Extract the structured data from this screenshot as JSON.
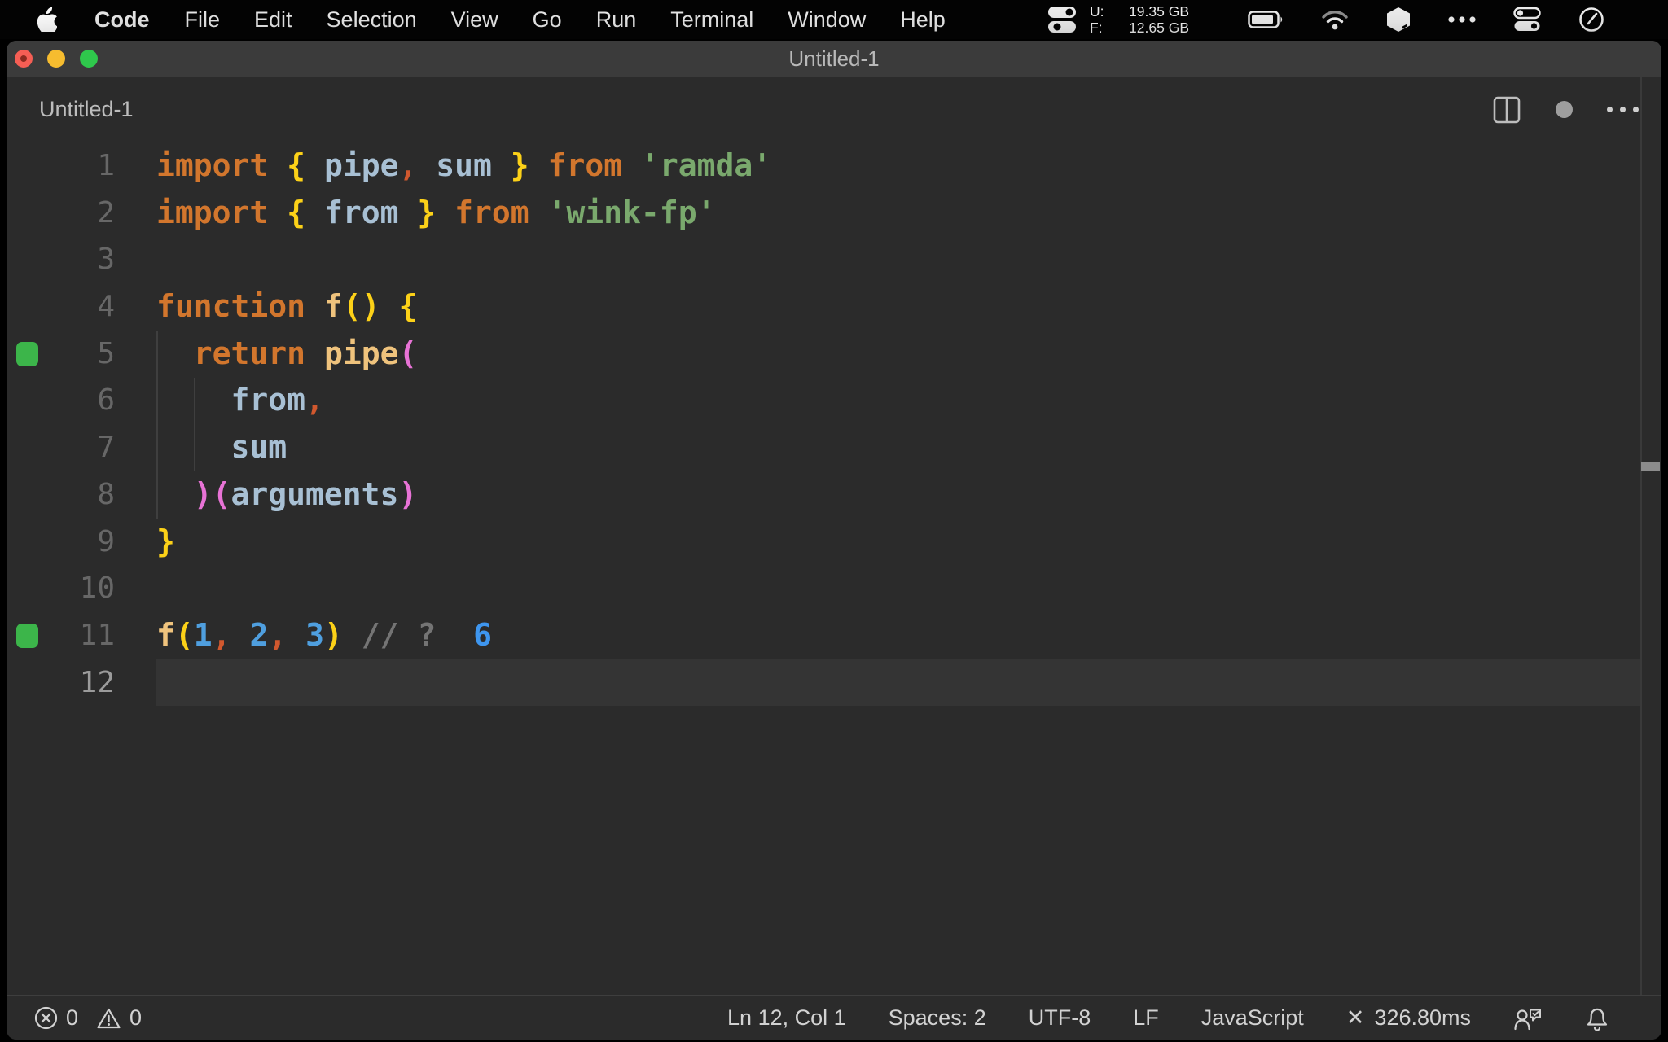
{
  "colors": {
    "plain": "#d0d0d0",
    "keyword": "#d2762d",
    "func": "#efc37d",
    "bracket1": "#fcd118",
    "bracket2": "#e873d6",
    "ident": "#a8c0d4",
    "punct": "#d1582e",
    "string": "#7aa96d",
    "number": "#4f9fdf",
    "comment": "#747474",
    "result": "#3e96ef",
    "marker": "#3cb54a"
  },
  "menu_bar": {
    "app_menu": "Code",
    "items": [
      "File",
      "Edit",
      "Selection",
      "View",
      "Go",
      "Run",
      "Terminal",
      "Window",
      "Help"
    ],
    "memory": {
      "used_label": "U:",
      "used_value": "19.35 GB",
      "free_label": "F:",
      "free_value": "12.65 GB"
    },
    "status_icons": [
      "stats-icon",
      "battery-icon",
      "wifi-icon",
      "cube-icon",
      "ellipsis-icon",
      "control-center-icon",
      "clock-icon"
    ]
  },
  "window": {
    "title": "Untitled-1"
  },
  "tab_bar": {
    "tab_label": "Untitled-1",
    "icons": [
      "split-editor-icon",
      "unsaved-dot-icon",
      "more-actions-icon"
    ]
  },
  "editor": {
    "language_hint": "javascript",
    "lines": [
      {
        "num": "1",
        "tokens": [
          [
            "keyword",
            "import"
          ],
          [
            "plain",
            " "
          ],
          [
            "bracket1",
            "{"
          ],
          [
            "plain",
            " "
          ],
          [
            "ident",
            "pipe"
          ],
          [
            "punct",
            ","
          ],
          [
            "plain",
            " "
          ],
          [
            "ident",
            "sum"
          ],
          [
            "plain",
            " "
          ],
          [
            "bracket1",
            "}"
          ],
          [
            "plain",
            " "
          ],
          [
            "keyword",
            "from"
          ],
          [
            "plain",
            " "
          ],
          [
            "string",
            "'ramda'"
          ]
        ]
      },
      {
        "num": "2",
        "tokens": [
          [
            "keyword",
            "import"
          ],
          [
            "plain",
            " "
          ],
          [
            "bracket1",
            "{"
          ],
          [
            "plain",
            " "
          ],
          [
            "ident",
            "from"
          ],
          [
            "plain",
            " "
          ],
          [
            "bracket1",
            "}"
          ],
          [
            "plain",
            " "
          ],
          [
            "keyword",
            "from"
          ],
          [
            "plain",
            " "
          ],
          [
            "string",
            "'wink-fp'"
          ]
        ]
      },
      {
        "num": "3",
        "tokens": []
      },
      {
        "num": "4",
        "tokens": [
          [
            "keyword",
            "function"
          ],
          [
            "plain",
            " "
          ],
          [
            "func",
            "f"
          ],
          [
            "bracket1",
            "()"
          ],
          [
            "plain",
            " "
          ],
          [
            "bracket1",
            "{"
          ]
        ]
      },
      {
        "num": "5",
        "marker": true,
        "tokens": [
          [
            "plain",
            "  "
          ],
          [
            "keyword",
            "return"
          ],
          [
            "plain",
            " "
          ],
          [
            "func",
            "pipe"
          ],
          [
            "bracket2",
            "("
          ]
        ]
      },
      {
        "num": "6",
        "tokens": [
          [
            "plain",
            "    "
          ],
          [
            "ident",
            "from"
          ],
          [
            "punct",
            ","
          ]
        ]
      },
      {
        "num": "7",
        "tokens": [
          [
            "plain",
            "    "
          ],
          [
            "ident",
            "sum"
          ]
        ]
      },
      {
        "num": "8",
        "tokens": [
          [
            "plain",
            "  "
          ],
          [
            "bracket2",
            ")("
          ],
          [
            "ident",
            "arguments"
          ],
          [
            "bracket2",
            ")"
          ]
        ]
      },
      {
        "num": "9",
        "tokens": [
          [
            "bracket1",
            "}"
          ]
        ]
      },
      {
        "num": "10",
        "tokens": []
      },
      {
        "num": "11",
        "marker": true,
        "tokens": [
          [
            "func",
            "f"
          ],
          [
            "bracket1",
            "("
          ],
          [
            "number",
            "1"
          ],
          [
            "punct",
            ","
          ],
          [
            "plain",
            " "
          ],
          [
            "number",
            "2"
          ],
          [
            "punct",
            ","
          ],
          [
            "plain",
            " "
          ],
          [
            "number",
            "3"
          ],
          [
            "bracket1",
            ")"
          ],
          [
            "plain",
            " "
          ],
          [
            "comment",
            "//"
          ],
          [
            "plain",
            " "
          ],
          [
            "comment",
            "?"
          ],
          [
            "plain",
            "  "
          ],
          [
            "result",
            "6"
          ]
        ]
      },
      {
        "num": "12",
        "active": true,
        "tokens": []
      }
    ]
  },
  "status_bar": {
    "errors": "0",
    "warnings": "0",
    "cursor_position": "Ln 12, Col 1",
    "indentation": "Spaces: 2",
    "encoding": "UTF-8",
    "eol": "LF",
    "language": "JavaScript",
    "perf_icon": "✕",
    "perf_time": "326.80ms",
    "right_icons": [
      "feedback-icon",
      "bell-icon"
    ]
  }
}
